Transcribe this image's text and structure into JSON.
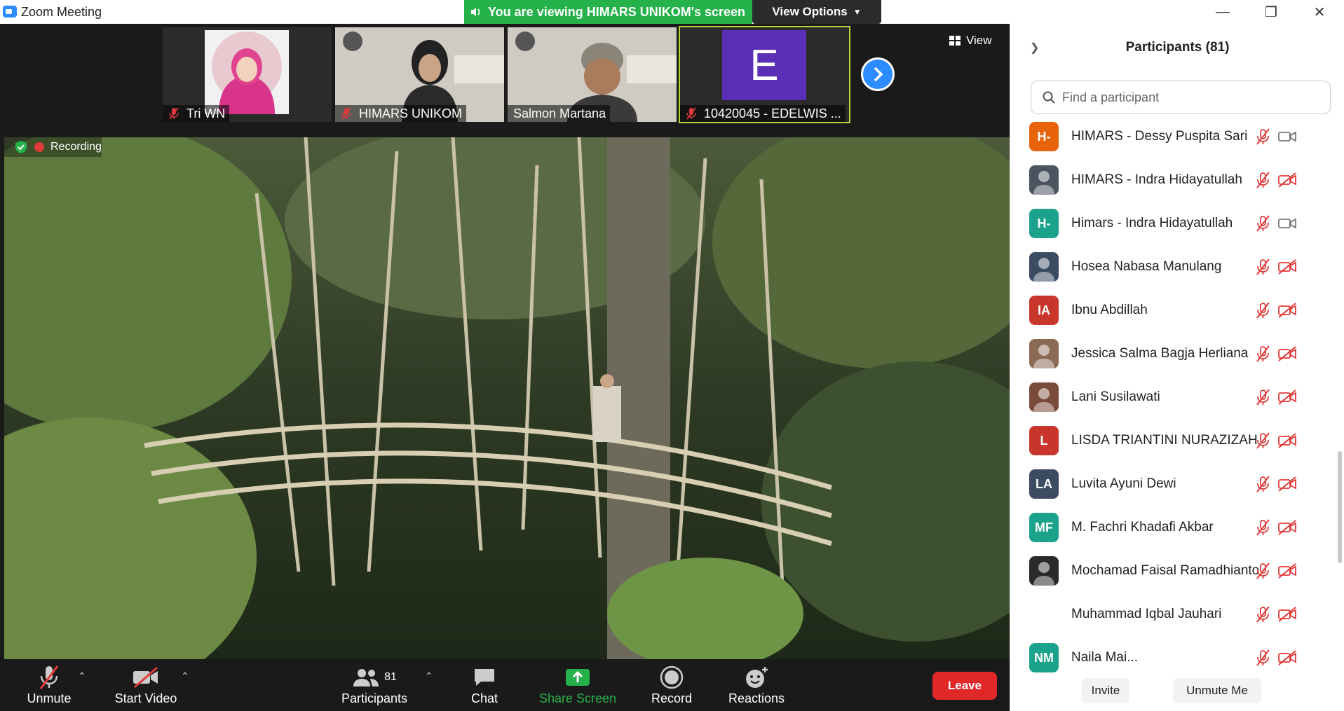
{
  "window": {
    "title": "Zoom Meeting",
    "minimize_glyph": "—",
    "restore_glyph": "❐",
    "close_glyph": "✕"
  },
  "share_banner": {
    "text": "You are viewing HIMARS UNIKOM's screen",
    "view_options_label": "View Options",
    "color": "#26b24a"
  },
  "thumbnails": [
    {
      "name": "Tri WN",
      "muted": true
    },
    {
      "name": "HIMARS UNIKOM",
      "muted": true
    },
    {
      "name": "Salmon Martana",
      "muted": false
    },
    {
      "name": "10420045 - EDELWIS ...",
      "muted": true,
      "initial": "E",
      "avatar_color": "#5b2eb8"
    }
  ],
  "view_button_label": "View",
  "recording_label": "Recording",
  "toolbar": {
    "unmute_label": "Unmute",
    "start_video_label": "Start Video",
    "participants_label": "Participants",
    "participants_count": "81",
    "chat_label": "Chat",
    "share_screen_label": "Share Screen",
    "record_label": "Record",
    "reactions_label": "Reactions",
    "leave_label": "Leave",
    "accent_green": "#26b24a",
    "leave_color": "#e02828"
  },
  "panel": {
    "title": "Participants (81)",
    "search_placeholder": "Find a participant",
    "invite_label": "Invite",
    "unmute_me_label": "Unmute Me",
    "participants": [
      {
        "name": "HIMARS - Dessy Puspita Sari",
        "initials": "H-",
        "color": "#e8640c",
        "video": true
      },
      {
        "name": "HIMARS - Indra Hidayatullah",
        "initials": "",
        "color": "#4b5560",
        "video": false
      },
      {
        "name": "Himars - Indra Hidayatullah",
        "initials": "H-",
        "color": "#1aa38a",
        "video": true
      },
      {
        "name": "Hosea Nabasa Manulang",
        "initials": "",
        "color": "#3b4b62",
        "video": false
      },
      {
        "name": "Ibnu Abdillah",
        "initials": "IA",
        "color": "#c8362b",
        "video": false
      },
      {
        "name": "Jessica Salma Bagja Herliana",
        "initials": "",
        "color": "#8a6a55",
        "video": false
      },
      {
        "name": "Lani Susilawati",
        "initials": "",
        "color": "#7a4a3a",
        "video": false
      },
      {
        "name": "LISDA TRIANTINI NURAZIZAH",
        "initials": "L",
        "color": "#c8362b",
        "video": false
      },
      {
        "name": "Luvita Ayuni Dewi",
        "initials": "LA",
        "color": "#3b4b62",
        "video": false
      },
      {
        "name": "M. Fachri Khadafi Akbar",
        "initials": "MF",
        "color": "#1aa38a",
        "video": false
      },
      {
        "name": "Mochamad Faisal Ramadhianto",
        "initials": "",
        "color": "#2a2a2a",
        "video": false
      },
      {
        "name": "Muhammad Iqbal Jauhari",
        "initials": "",
        "color": "#ffffff",
        "video": false
      },
      {
        "name": "Naila Mai...",
        "initials": "NM",
        "color": "#1aa38a",
        "video": false
      }
    ]
  }
}
